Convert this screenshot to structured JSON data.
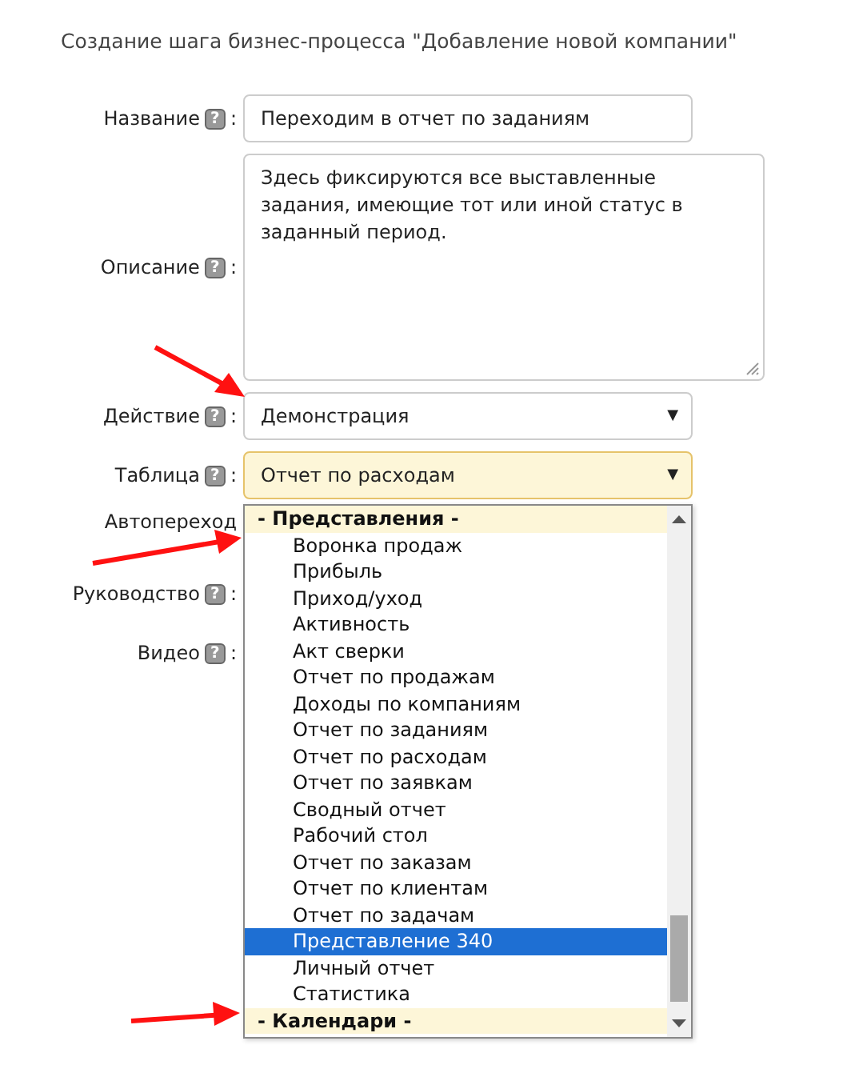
{
  "title": "Создание шага бизнес-процесса \"Добавление новой компании\"",
  "fields": [
    {
      "label": "Название",
      "colon": ":",
      "help": "?",
      "kind": "input",
      "value": "Переходим в отчет по заданиям"
    },
    {
      "label": "Описание",
      "colon": ":",
      "help": "?",
      "kind": "textarea",
      "value": "Здесь фиксируются все выставленные задания, имеющие тот или иной статус в заданный период."
    },
    {
      "label": "Действие",
      "colon": ":",
      "help": "?",
      "kind": "select",
      "value": "Демонстрация",
      "focused": false
    },
    {
      "label": "Таблица",
      "colon": ":",
      "help": "?",
      "kind": "select",
      "value": "Отчет по расходам",
      "focused": true
    },
    {
      "label": "Автопереход",
      "kind": "hidden"
    },
    {
      "label": "Руководство",
      "colon": ":",
      "help": "?",
      "kind": "hidden"
    },
    {
      "label": "Видео",
      "colon": ":",
      "help": "?",
      "kind": "hidden"
    }
  ],
  "dropdown": {
    "caret": "▼",
    "options": [
      {
        "kind": "group",
        "text": "- Представления -",
        "selected": false
      },
      {
        "kind": "option",
        "text": "Воронка продаж",
        "selected": false
      },
      {
        "kind": "option",
        "text": "Прибыль",
        "selected": false
      },
      {
        "kind": "option",
        "text": "Приход/уход",
        "selected": false
      },
      {
        "kind": "option",
        "text": "Активность",
        "selected": false
      },
      {
        "kind": "option",
        "text": "Акт сверки",
        "selected": false
      },
      {
        "kind": "option",
        "text": "Отчет по продажам",
        "selected": false
      },
      {
        "kind": "option",
        "text": "Доходы по компаниям",
        "selected": false
      },
      {
        "kind": "option",
        "text": "Отчет по заданиям",
        "selected": false
      },
      {
        "kind": "option",
        "text": "Отчет по расходам",
        "selected": false
      },
      {
        "kind": "option",
        "text": "Отчет по заявкам",
        "selected": false
      },
      {
        "kind": "option",
        "text": "Сводный отчет",
        "selected": false
      },
      {
        "kind": "option",
        "text": "Рабочий стол",
        "selected": false
      },
      {
        "kind": "option",
        "text": "Отчет по заказам",
        "selected": false
      },
      {
        "kind": "option",
        "text": "Отчет по клиентам",
        "selected": false
      },
      {
        "kind": "option",
        "text": "Отчет по задачам",
        "selected": false
      },
      {
        "kind": "option",
        "text": "Представление 340",
        "selected": true
      },
      {
        "kind": "option",
        "text": "Личный отчет",
        "selected": false
      },
      {
        "kind": "option",
        "text": "Статистика",
        "selected": false
      },
      {
        "kind": "group",
        "text": "- Календари -",
        "selected": false
      }
    ]
  }
}
